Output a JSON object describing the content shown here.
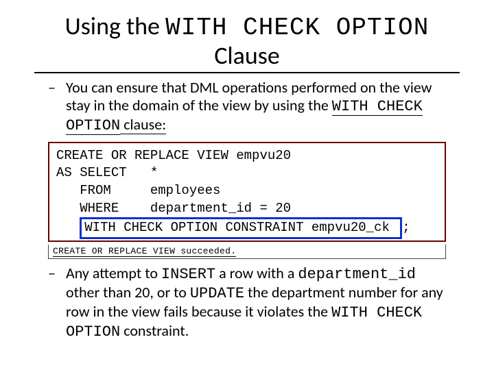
{
  "title": {
    "pre": "Using the ",
    "code": "WITH CHECK OPTION",
    "post": " Clause"
  },
  "bullet1": {
    "pre": "You can ensure that DML operations performed on the view stay in the domain of the view by using the ",
    "code": "WITH CHECK OPTION",
    "post": " clause:"
  },
  "sql": {
    "l1": "CREATE OR REPLACE VIEW empvu20",
    "l2": "AS SELECT   *",
    "l3": "   FROM     employees",
    "l4": "   WHERE    department_id = 20",
    "l5a": "   ",
    "l5box": "WITH CHECK OPTION CONSTRAINT empvu20_ck ",
    "l5b": ";"
  },
  "result": "CREATE OR REPLACE VIEW succeeded.",
  "bullet2": {
    "p1": "Any attempt to ",
    "c1": "INSERT",
    "p2": " a row with a ",
    "c2": "department_id",
    "p3": " other than 20, or to ",
    "c3": "UPDATE",
    "p4": " the department number for any row in the view fails because it violates the ",
    "c4": "WITH CHECK OPTION",
    "p5": " constraint."
  }
}
